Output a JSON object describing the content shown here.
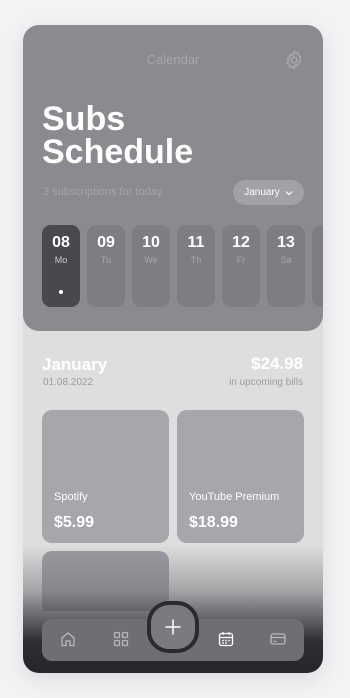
{
  "header": {
    "title": "Calendar",
    "icon": "gear-icon"
  },
  "hero": {
    "title_line1": "Subs",
    "title_line2": "Schedule",
    "subtitle": "3 subscriptions for today",
    "month_select": "January"
  },
  "days": [
    {
      "num": "08",
      "weekday": "Mo",
      "selected": true
    },
    {
      "num": "09",
      "weekday": "Tu",
      "selected": false
    },
    {
      "num": "10",
      "weekday": "We",
      "selected": false
    },
    {
      "num": "11",
      "weekday": "Th",
      "selected": false
    },
    {
      "num": "12",
      "weekday": "Fr",
      "selected": false
    },
    {
      "num": "13",
      "weekday": "Sa",
      "selected": false
    },
    {
      "num": "14",
      "weekday": "Su",
      "selected": false
    }
  ],
  "summary": {
    "month": "January",
    "date": "01.08.2022",
    "amount": "$24.98",
    "amount_label": "in upcoming bills"
  },
  "subscriptions": [
    {
      "name": "Spotify",
      "price": "$5.99"
    },
    {
      "name": "YouTube Premium",
      "price": "$18.99"
    }
  ],
  "nav": {
    "items": [
      "home-icon",
      "grid-icon",
      "calendar-icon",
      "card-icon"
    ],
    "add_button": "plus-icon"
  },
  "colors": {
    "header_bg": "#8a8a8f",
    "selected_day": "#48484f",
    "card_bg": "#a6a6ab",
    "nav_bg": "#6e6e75"
  }
}
